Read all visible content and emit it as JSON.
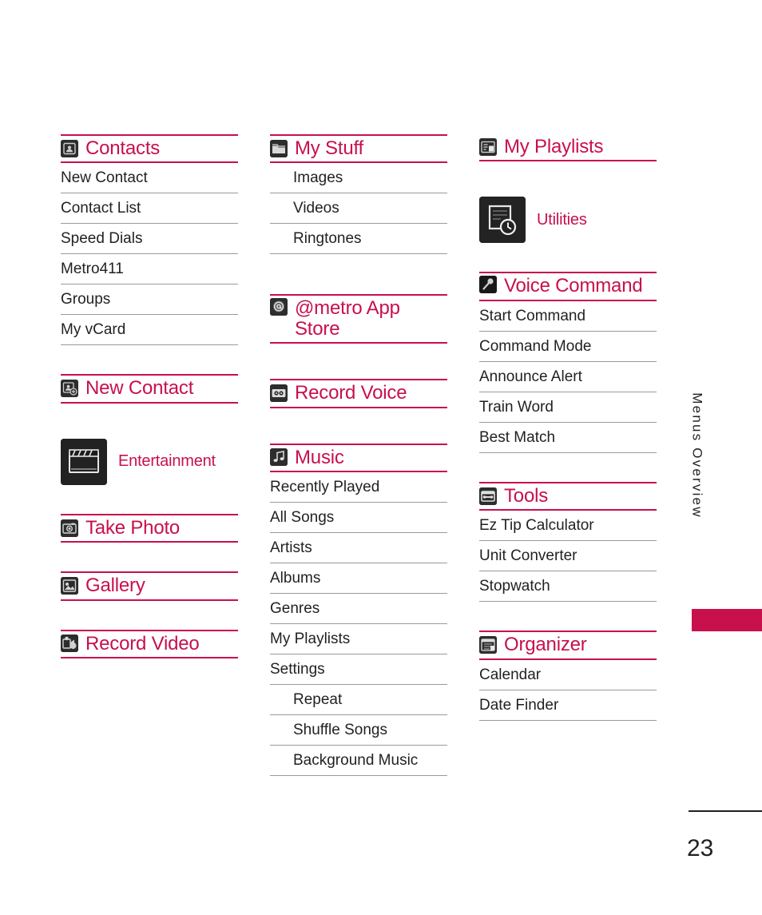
{
  "page": {
    "number": "23",
    "edge_label": "Menus Overview",
    "accent_color": "#c8104c",
    "text_color": "#231f20"
  },
  "columns": [
    {
      "id": "column-1",
      "sections": [
        {
          "id": "contacts",
          "title": "Contacts",
          "icon": "contacts-icon",
          "icon_size": "22",
          "items": [
            "New Contact",
            "Contact List",
            "Speed Dials",
            "Metro411",
            "Groups",
            "My vCard"
          ]
        },
        {
          "id": "new-contact",
          "title": "New Contact",
          "icon": "new-contact-icon",
          "icon_size": "22",
          "items": []
        },
        {
          "id": "entertainment",
          "title": "Entertainment",
          "icon": "clapperboard-icon",
          "icon_size": "58",
          "items": []
        },
        {
          "id": "take-photo",
          "title": "Take Photo",
          "icon": "camera-photo-icon",
          "icon_size": "22",
          "items": []
        },
        {
          "id": "gallery",
          "title": "Gallery",
          "icon": "gallery-icon",
          "icon_size": "22",
          "items": []
        },
        {
          "id": "record-video",
          "title": "Record Video",
          "icon": "camcorder-icon",
          "icon_size": "22",
          "items": []
        }
      ]
    },
    {
      "id": "column-2",
      "sections": [
        {
          "id": "my-stuff",
          "title": "My Stuff",
          "icon": "folder-icon",
          "icon_size": "22",
          "items": [
            "Images",
            "Videos",
            "Ringtones"
          ],
          "items_indented": true
        },
        {
          "id": "metro-app-store",
          "title": "@metro App Store",
          "icon": "at-sphere-icon",
          "icon_size": "22",
          "items": []
        },
        {
          "id": "record-voice",
          "title": "Record Voice",
          "icon": "cassette-tape-icon",
          "icon_size": "22",
          "items": []
        },
        {
          "id": "music",
          "title": "Music",
          "icon": "music-notes-icon",
          "icon_size": "22",
          "items": [
            "Recently Played",
            "All Songs",
            "Artists",
            "Albums",
            "Genres",
            "My Playlists",
            "Settings"
          ],
          "sub_items": [
            "Repeat",
            "Shuffle Songs",
            "Background Music"
          ]
        }
      ]
    },
    {
      "id": "column-3",
      "sections": [
        {
          "id": "my-playlists",
          "title": "My Playlists",
          "icon": "playlist-icon",
          "icon_size": "22",
          "items": []
        },
        {
          "id": "utilities",
          "title": "Utilities",
          "icon": "utilities-clock-icon",
          "icon_size": "58",
          "items": []
        },
        {
          "id": "voice-command",
          "title": "Voice Command",
          "icon": "microphone-icon",
          "icon_size": "22",
          "items": [
            "Start Command",
            "Command Mode",
            "Announce Alert",
            "Train Word",
            "Best Match"
          ]
        },
        {
          "id": "tools",
          "title": "Tools",
          "icon": "toolbox-icon",
          "icon_size": "22",
          "items": [
            "Ez Tip Calculator",
            "Unit Converter",
            "Stopwatch"
          ]
        },
        {
          "id": "organizer",
          "title": "Organizer",
          "icon": "calendar-organizer-icon",
          "icon_size": "22",
          "items": [
            "Calendar",
            "Date Finder"
          ]
        }
      ]
    }
  ]
}
